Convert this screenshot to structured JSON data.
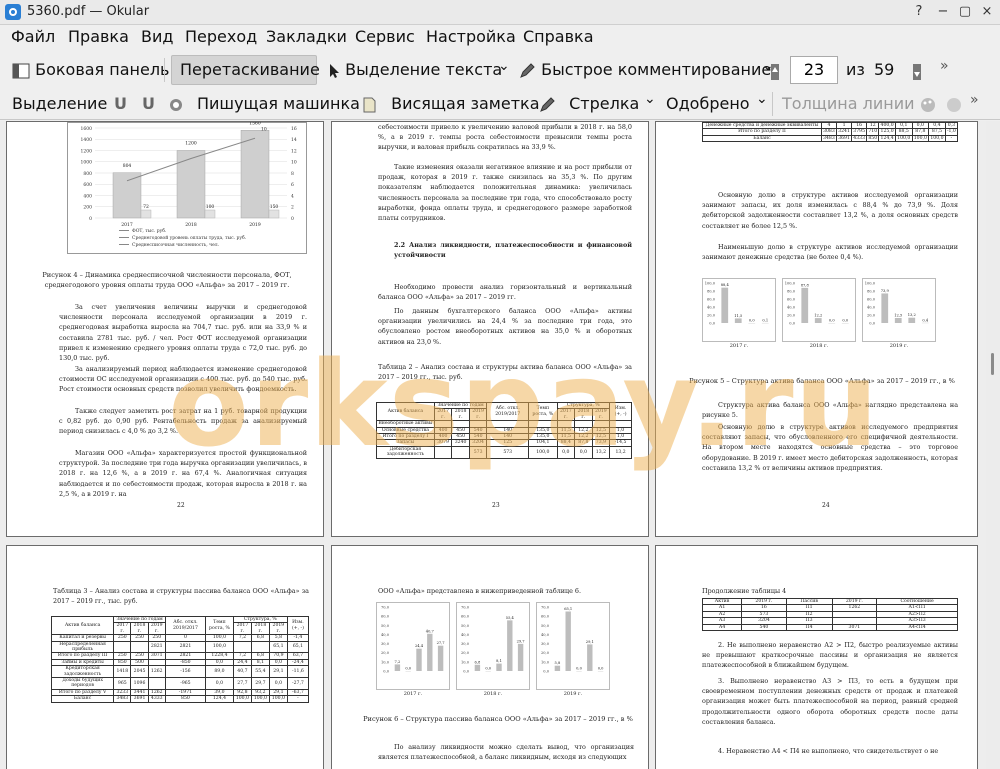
{
  "window": {
    "title": "5360.pdf — Okular",
    "buttons": [
      "?",
      "−",
      "▢",
      "×"
    ]
  },
  "menu": [
    "Файл",
    "Правка",
    "Вид",
    "Переход",
    "Закладки",
    "Сервис",
    "Настройка",
    "Справка"
  ],
  "toolbar1": {
    "sidebar": "Боковая панель",
    "drag": "Перетаскивание",
    "text_select": "Выделение текста",
    "quick_comment": "Быстрое комментирование",
    "page_current": "23",
    "page_of": "из",
    "page_total": "59"
  },
  "toolbar2": {
    "select": "Выделение",
    "typewriter": "Пишущая машинка",
    "hanging_note": "Висящая заметка",
    "arrow": "Стрелка",
    "approved": "Одобрено",
    "line_width": "Толщина линии"
  },
  "watermark": "orkspay.ru",
  "pages": {
    "p22": {
      "chart": {
        "years": [
          "2017",
          "2018",
          "2019"
        ],
        "left_ticks": [
          "1600",
          "1400",
          "1200",
          "1000",
          "800",
          "600",
          "400",
          "200",
          "0"
        ],
        "right_ticks": [
          "16",
          "14",
          "12",
          "10",
          "8",
          "6",
          "4",
          "2",
          "0"
        ],
        "bars": [
          {
            "v": 804,
            "label": "804"
          },
          {
            "v": 1200,
            "label": "1200"
          },
          {
            "v": 1560,
            "label": "1560"
          }
        ],
        "small_labels": [
          "72",
          "100",
          "150"
        ],
        "line_labels": [
          "10"
        ],
        "legend": [
          "ФОТ, тыс. руб.",
          "Среднегодовой уровень оплаты труда, тыс. руб.",
          "Среднесписочная численность, чел."
        ]
      },
      "caption": "Рисунок 4 – Динамика среднесписочной численности персонала, ФОТ, среднегодового уровня оплаты труда ООО «Альфа» за 2017 – 2019 гг.",
      "paras": [
        "За счет увеличения величины выручки и среднегодовой численности персонала исследуемой организации в 2019 г. среднегодовая выработка выросла на 704,7 тыс. руб. или на 33,9 % и составила 2781 тыс. руб. / чел. Рост ФОТ исследуемой организации привел к изменению среднего уровня оплаты труда с 72,0 тыс. руб. до 130,0 тыс. руб.",
        "За анализируемый период наблюдается изменение среднегодовой стоимости ОС исследуемой организации с 400 тыс. руб. до 540 тыс. руб. Рост стоимости основных средств позволил увеличить фондоемкость.",
        "Также следует заметить рост затрат на 1 руб. товарной продукции с 0,82 руб. до 0,90 руб. Рентабельность продаж за анализируемый период снизилась с 4,0 % до 3,2 %.",
        "Магазин ООО «Альфа» характеризуется простой функциональной структурой. За последние три года выручка организации увеличилась, в 2018 г. на 12,6 %, а в 2019 г. на 67,4 %. Аналогичная ситуация наблюдается и по себестоимости продаж, которая выросла в 2018 г. на 2,5 %, а в 2019 г. на"
      ],
      "page_no": "22"
    },
    "p23": {
      "paras_top": [
        "себестоимости привело к увеличению валовой прибыли в 2018 г. на 58,0 %, а в 2019 г. темпы роста себестоимости превысили темпы роста выручки, и валовая прибыль сократилась на 33,9 %.",
        "Такие изменения оказали негативное влияние и на рост прибыли от продаж, которая в 2019 г. также снизилась на 35,3 %. По другим показателям наблюдается положительная динамика: увеличилась численность персонала за последние три года, что способствовало росту выработки, фонда оплаты труда, и среднегодового размере заработной платы сотрудников."
      ],
      "heading": "2.2 Анализ ликвидности, платежеспособности и финансовой устойчивости",
      "paras_mid": [
        "Необходимо провести анализ горизонтальный и вертикальный баланса ООО «Альфа» за 2017 – 2019 гг.",
        "По данным бухгалтерского баланса ООО «Альфа» активы организации увеличились на 24,4 % за последние три года, это обусловлено ростом внеоборотных активов на 35,0 % и оборотных активов на 23,0 %."
      ],
      "table_title": "Таблица 2 – Анализ состава и структуры актива баланса ООО «Альфа» за 2017 – 2019 гг., тыс. руб.",
      "table": {
        "head1": [
          "Актив баланса",
          "Значение по годам",
          "Абс. откл. 2019/2017",
          "Темп роста, %",
          "Структура, %",
          "Изм. (+, -)"
        ],
        "head2": [
          "2017 г.",
          "2018 г.",
          "2019 г.",
          "2017 г.",
          "2018 г.",
          "2019 г."
        ],
        "rows": [
          [
            "Внеоборотные активы",
            "",
            "",
            "",
            "",
            "",
            "",
            "",
            "",
            ""
          ],
          [
            "Основные средства",
            "400",
            "450",
            "540",
            "140",
            "135,0",
            "11,5",
            "12,2",
            "12,5",
            "1,0"
          ],
          [
            "Итого по разделу I",
            "400",
            "450",
            "540",
            "140",
            "135,0",
            "11,5",
            "12,2",
            "12,5",
            "1,0"
          ],
          [
            "Запасы",
            "3079",
            "3240",
            "3204",
            "125",
            "104,1",
            "88,4",
            "87,8",
            "73,9",
            "-14,5"
          ],
          [
            "Дебиторская задолженность",
            "",
            "",
            "573",
            "573",
            "100,0",
            "0,0",
            "0,0",
            "13,2",
            "13,2"
          ]
        ]
      },
      "page_no": "23"
    },
    "p24": {
      "table_rows": [
        [
          "Денежные средства и денежные эквиваленты",
          "4",
          "1",
          "16",
          "12",
          "400,0",
          "0,1",
          "0,0",
          "0,4",
          "0,3"
        ],
        [
          "Итого по разделу II",
          "3083",
          "3241",
          "3795",
          "710",
          "125,0",
          "88,5",
          "87,8",
          "87,5",
          "-1,0"
        ],
        [
          "Баланс",
          "3483",
          "3691",
          "4333",
          "850",
          "124,4",
          "100,0",
          "100,0",
          "100,0",
          "-"
        ]
      ],
      "paras": [
        "Основную долю в структуре активов исследуемой организации занимают запасы, их доля изменилась с 88,4 % до 73,9 %. Доля дебиторской задолженности составляет 13,2 %, а доля основных средств составляет не более 12,5 %.",
        "Наименьшую долю в структуре активов исследуемой организации занимают денежные средства (не более 0,4 %)."
      ],
      "mini_years": [
        "2017 г.",
        "2018 г.",
        "2019 г."
      ],
      "mini_values": [
        [
          "88,4",
          "11,5",
          "0,0",
          "0,1"
        ],
        [
          "87,8",
          "12,2",
          "0,0",
          "0,0"
        ],
        [
          "73,9",
          "12,5",
          "13,2",
          "0,4"
        ]
      ],
      "mini_ticks": [
        "100,0",
        "80,0",
        "60,0",
        "40,0",
        "20,0",
        "0,0"
      ],
      "caption": "Рисунок 5 – Структура актива баланса ООО «Альфа» за 2017 – 2019 гг., в %",
      "paras2": [
        "Структура актива баланса ООО «Альфа» наглядно представлена на рисунке 5.",
        "Основную долю в структуре активов исследуемого предприятия составляют запасы, что обусловленного его специфичной деятельности. На втором месте находятся основные средства – это торговое оборудование. В 2019 г. имеет место дебиторская задолженность, которая составила 13,2 % от величины активов предприятия."
      ],
      "page_no": "24"
    },
    "p25": {
      "table_title": "Таблица 3 – Анализ состава и структуры пассива баланса ООО «Альфа» за 2017 – 2019 гг., тыс. руб.",
      "head1": [
        "Актив баланса",
        "Значение по годам",
        "Абс. откл. 2019/2017",
        "Темп роста, %",
        "Структура, %",
        "Изм. (+, -)"
      ],
      "head2": [
        "2017 г.",
        "2018 г.",
        "2019 г.",
        "2017 г.",
        "2018 г.",
        "2019 г."
      ],
      "rows": [
        [
          "Капитал и резервы",
          "250",
          "250",
          "250",
          "0",
          "100,0",
          "7,2",
          "6,8",
          "5,8",
          "-1,4"
        ],
        [
          "Нераспределенная прибыль",
          "",
          "",
          "2821",
          "2821",
          "100,0",
          "",
          "",
          "65,1",
          "65,1"
        ],
        [
          "Итого по разделу III",
          "250",
          "250",
          "3071",
          "2821",
          "1228,4",
          "7,2",
          "6,8",
          "70,9",
          "63,7"
        ],
        [
          "Займы и кредиты",
          "850",
          "500",
          "",
          "-850",
          "0,0",
          "24,4",
          "8,1",
          "0,0",
          "-24,4"
        ],
        [
          "Кредиторская задолженность",
          "1418",
          "2045",
          "1262",
          "-156",
          "89,0",
          "40,7",
          "55,4",
          "29,1",
          "-11,6"
        ],
        [
          "Доходы будущих периодов",
          "965",
          "1096",
          "",
          "-965",
          "0,0",
          "27,7",
          "29,7",
          "0,0",
          "-27,7"
        ],
        [
          "Итого по разделу V",
          "3233",
          "3441",
          "1262",
          "-1971",
          "39,0",
          "92,8",
          "93,2",
          "29,1",
          "-63,7"
        ],
        [
          "Баланс",
          "3483",
          "3691",
          "4333",
          "850",
          "124,4",
          "100,0",
          "100,0",
          "100,0",
          "-"
        ]
      ]
    },
    "p26": {
      "top": "ООО «Альфа» представлена в нижеприведенной таблице 6.",
      "mini_years": [
        "2017 г.",
        "2018 г.",
        "2019 г."
      ],
      "mini_values": [
        [
          "7,2",
          "0,0",
          "24,4",
          "40,7",
          "27,7"
        ],
        [
          "6,8",
          "0,0",
          "8,1",
          "55,4",
          "29,7"
        ],
        [
          "5,8",
          "65,1",
          "0,0",
          "29,1",
          "0,0"
        ]
      ],
      "mini_ticks": [
        "70,0",
        "60,0",
        "50,0",
        "40,0",
        "30,0",
        "20,0",
        "10,0",
        "0,0"
      ],
      "caption": "Рисунок 6 – Структура пассива баланса ООО «Альфа» за 2017 – 2019 гг., в %",
      "para": "По анализу ликвидности можно сделать вывод, что организация является платежеспособной, а баланс ликвидным, исходя из следующих"
    },
    "p27": {
      "title": "Продолжение таблицы 4",
      "head": [
        "Актив",
        "2019 г.",
        "Пассив",
        "2019 г.",
        "Соотношение"
      ],
      "rows": [
        [
          "А1",
          "16",
          "П1",
          "1262",
          "А1<П1"
        ],
        [
          "А2",
          "573",
          "П2",
          "",
          "А2>П2"
        ],
        [
          "А3",
          "3204",
          "П3",
          "",
          "А3>П3"
        ],
        [
          "А4",
          "540",
          "П4",
          "3071",
          "А4<П4"
        ]
      ],
      "paras": [
        "2. Не выполнено неравенство А2 > П2, быстро реализуемые активы не превышают краткосрочные пассивы и организация не является платежеспособной в ближайшем будущем.",
        "3. Выполнено неравенство А3 > П3, то есть в будущем при своевременном поступлении денежных средств от продаж и платежей организация может быть платежеспособной на период, равный средней продолжительности одного оборота оборотных средств после даты составления баланса.",
        "4. Неравенство А4 < П4 не выполнено, что свидетельствует о не"
      ]
    }
  }
}
